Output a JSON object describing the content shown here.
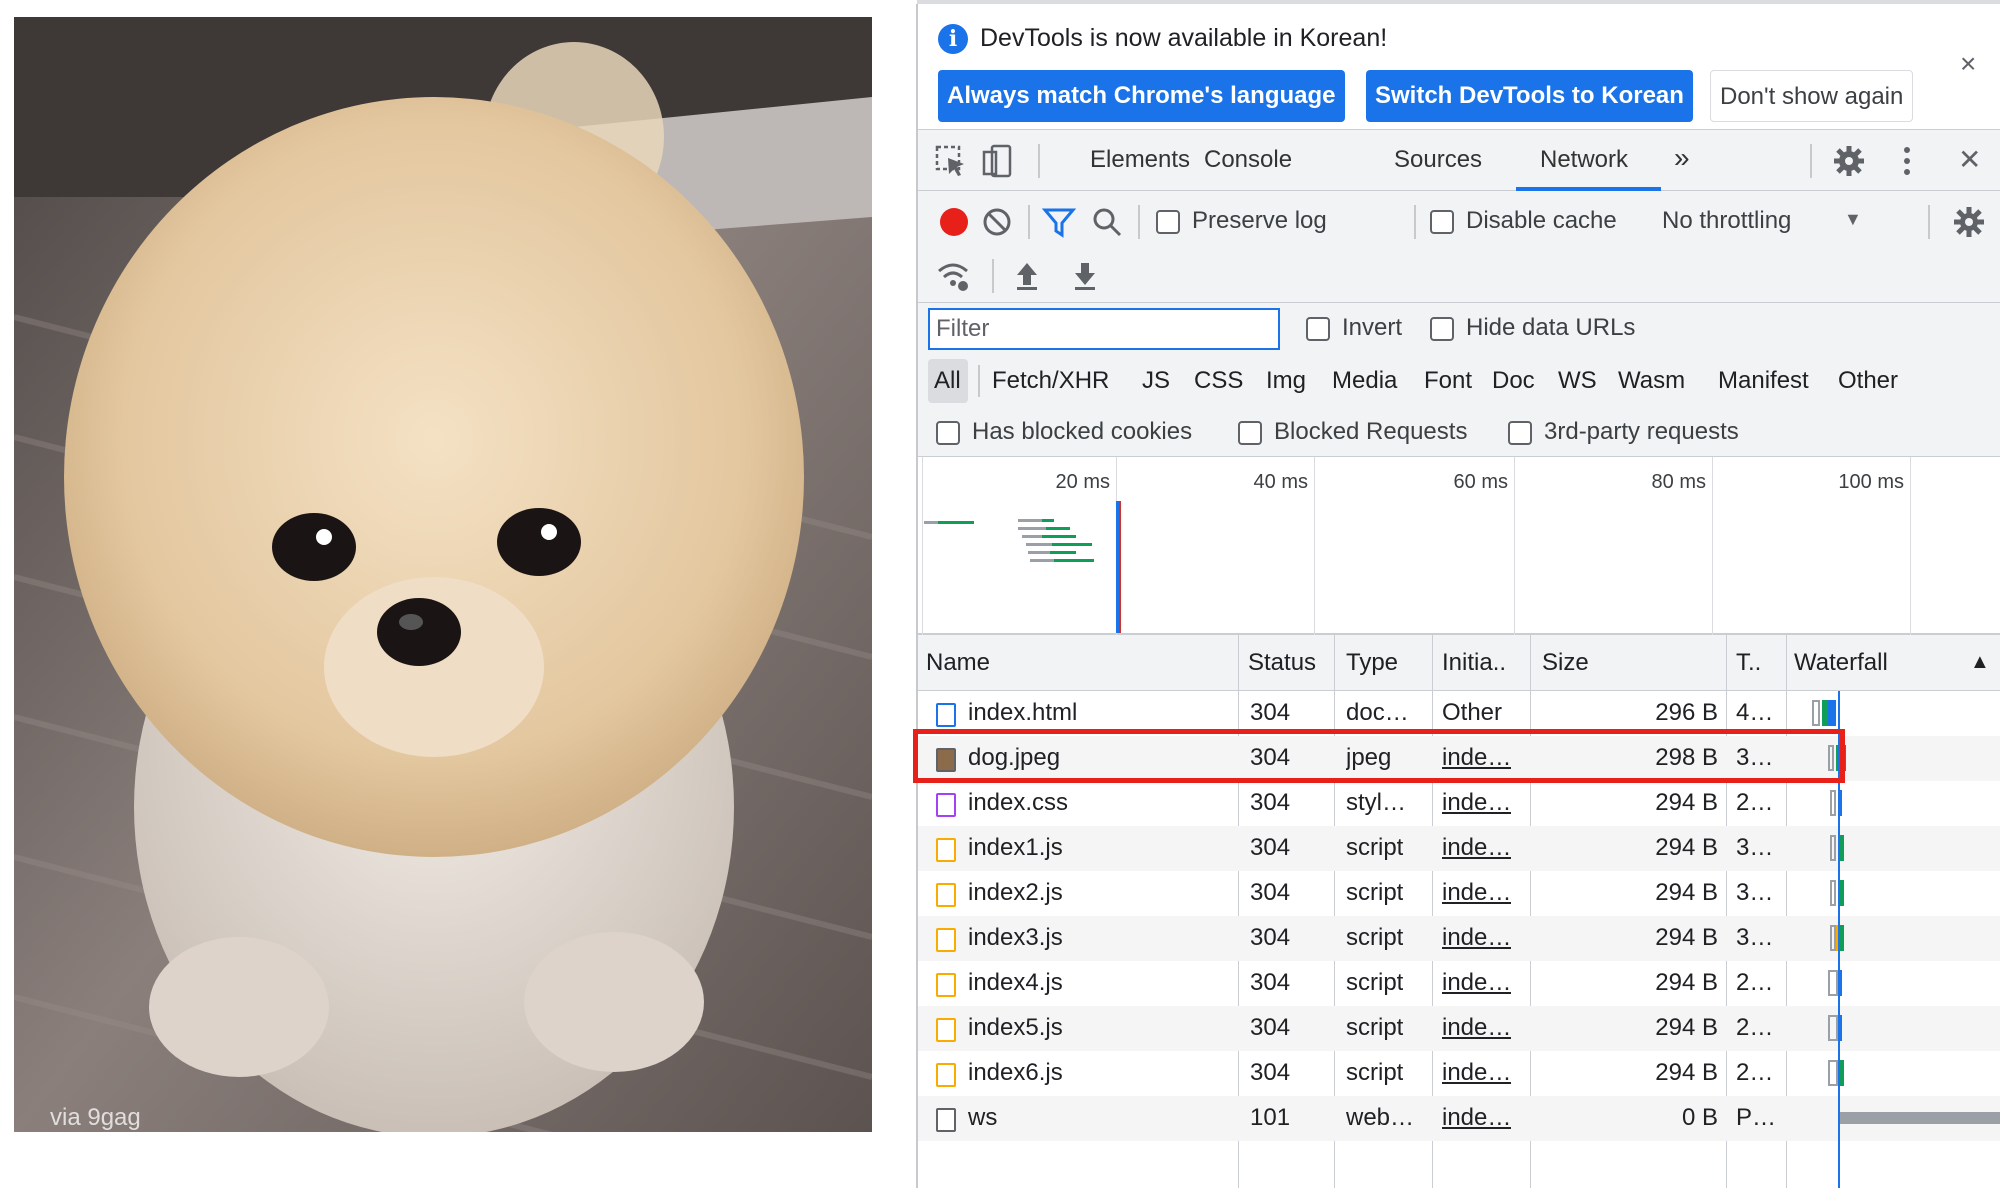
{
  "page": {
    "image_caption": "via 9gag"
  },
  "infobar": {
    "message": "DevTools is now available in Korean!",
    "info_icon": "i",
    "close": "×",
    "buttons": {
      "match": "Always match Chrome's language",
      "switch": "Switch DevTools to Korean",
      "dont_show": "Don't show again"
    }
  },
  "tabs": {
    "elements": "Elements",
    "console": "Console",
    "sources": "Sources",
    "network": "Network",
    "more": "»",
    "close": "✕"
  },
  "toolbar": {
    "preserve_log": "Preserve log",
    "disable_cache": "Disable cache",
    "throttling": "No throttling",
    "dropdown_arrow": "▼"
  },
  "filter": {
    "placeholder": "Filter",
    "invert": "Invert",
    "hide_data_urls": "Hide data URLs",
    "types": [
      "All",
      "Fetch/XHR",
      "JS",
      "CSS",
      "Img",
      "Media",
      "Font",
      "Doc",
      "WS",
      "Wasm",
      "Manifest",
      "Other"
    ],
    "has_blocked_cookies": "Has blocked cookies",
    "blocked_requests": "Blocked Requests",
    "third_party": "3rd-party requests"
  },
  "overview": {
    "ticks": [
      "20 ms",
      "40 ms",
      "60 ms",
      "80 ms",
      "100 ms"
    ]
  },
  "grid": {
    "headers": {
      "name": "Name",
      "status": "Status",
      "type": "Type",
      "initiator": "Initia..",
      "size": "Size",
      "time": "T..",
      "waterfall": "Waterfall",
      "sort_arrow": "▲"
    },
    "rows": [
      {
        "name": "index.html",
        "status": "304",
        "type": "doc…",
        "initiator": "Other",
        "size": "296 B",
        "time": "4…"
      },
      {
        "name": "dog.jpeg",
        "status": "304",
        "type": "jpeg",
        "initiator": "inde…",
        "size": "298 B",
        "time": "3…"
      },
      {
        "name": "index.css",
        "status": "304",
        "type": "styl…",
        "initiator": "inde…",
        "size": "294 B",
        "time": "2…"
      },
      {
        "name": "index1.js",
        "status": "304",
        "type": "script",
        "initiator": "inde…",
        "size": "294 B",
        "time": "3…"
      },
      {
        "name": "index2.js",
        "status": "304",
        "type": "script",
        "initiator": "inde…",
        "size": "294 B",
        "time": "3…"
      },
      {
        "name": "index3.js",
        "status": "304",
        "type": "script",
        "initiator": "inde…",
        "size": "294 B",
        "time": "3…"
      },
      {
        "name": "index4.js",
        "status": "304",
        "type": "script",
        "initiator": "inde…",
        "size": "294 B",
        "time": "2…"
      },
      {
        "name": "index5.js",
        "status": "304",
        "type": "script",
        "initiator": "inde…",
        "size": "294 B",
        "time": "2…"
      },
      {
        "name": "index6.js",
        "status": "304",
        "type": "script",
        "initiator": "inde…",
        "size": "294 B",
        "time": "2…"
      },
      {
        "name": "ws",
        "status": "101",
        "type": "web…",
        "initiator": "inde…",
        "size": "0 B",
        "time": "P…"
      }
    ],
    "highlighted_row": "dog.jpeg"
  }
}
